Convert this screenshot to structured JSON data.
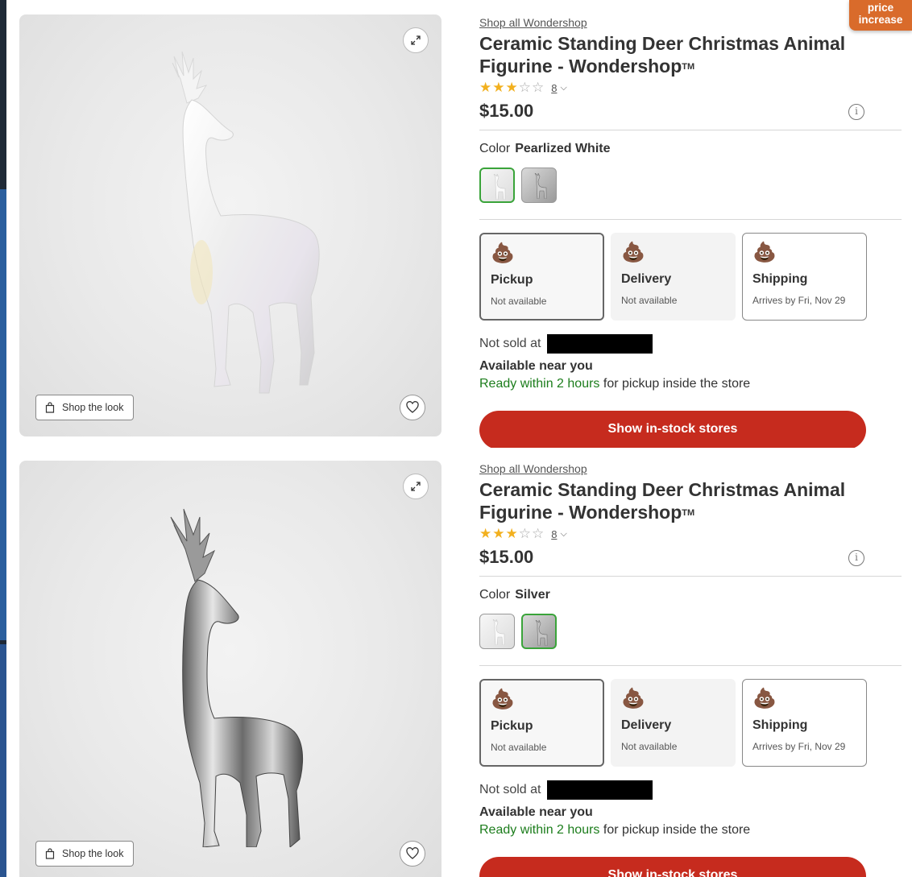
{
  "badge": {
    "text_line1": "price",
    "text_line2": "increase"
  },
  "products": [
    {
      "brand_link": "Shop all Wondershop",
      "title": "Ceramic Standing Deer Christmas Animal Figurine - Wondershop",
      "trademark": "TM",
      "rating": {
        "stars_filled": "★★★",
        "stars_empty": "☆☆",
        "value": 3,
        "out_of": 5,
        "count": "8",
        "chevron": "⌵"
      },
      "price": "$15.00",
      "info_icon": "i",
      "color_label": "Color",
      "color_value": "Pearlized White",
      "swatches": [
        {
          "name": "Pearlized White",
          "selected": true
        },
        {
          "name": "Silver",
          "selected": false
        }
      ],
      "fulfillment": [
        {
          "emoji": "💩",
          "title": "Pickup",
          "sub": "Not available"
        },
        {
          "emoji": "💩",
          "title": "Delivery",
          "sub": "Not available"
        },
        {
          "emoji": "💩",
          "title": "Shipping",
          "sub": "Arrives by Fri, Nov 29"
        }
      ],
      "not_sold_label": "Not sold at",
      "available_title": "Available near you",
      "ready_green": "Ready within 2 hours",
      "ready_rest": " for pickup inside the store",
      "cta": "Show in-stock stores",
      "shop_the_look": "Shop the look"
    },
    {
      "brand_link": "Shop all Wondershop",
      "title": "Ceramic Standing Deer Christmas Animal Figurine - Wondershop",
      "trademark": "TM",
      "rating": {
        "stars_filled": "★★★",
        "stars_empty": "☆☆",
        "value": 3,
        "out_of": 5,
        "count": "8",
        "chevron": "⌵"
      },
      "price": "$15.00",
      "info_icon": "i",
      "color_label": "Color",
      "color_value": "Silver",
      "swatches": [
        {
          "name": "Pearlized White",
          "selected": false
        },
        {
          "name": "Silver",
          "selected": true
        }
      ],
      "fulfillment": [
        {
          "emoji": "💩",
          "title": "Pickup",
          "sub": "Not available"
        },
        {
          "emoji": "💩",
          "title": "Delivery",
          "sub": "Not available"
        },
        {
          "emoji": "💩",
          "title": "Shipping",
          "sub": "Arrives by Fri, Nov 29"
        }
      ],
      "not_sold_label": "Not sold at",
      "available_title": "Available near you",
      "ready_green": "Ready within 2 hours",
      "ready_rest": " for pickup inside the store",
      "cta": "Show in-stock stores",
      "shop_the_look": "Shop the look"
    }
  ],
  "colors": {
    "accent_red": "#c62b1e",
    "selected_green": "#3aa43a",
    "ready_green": "#1c7d1c",
    "star_gold": "#f2b01e",
    "badge_orange": "#d96b2b"
  }
}
